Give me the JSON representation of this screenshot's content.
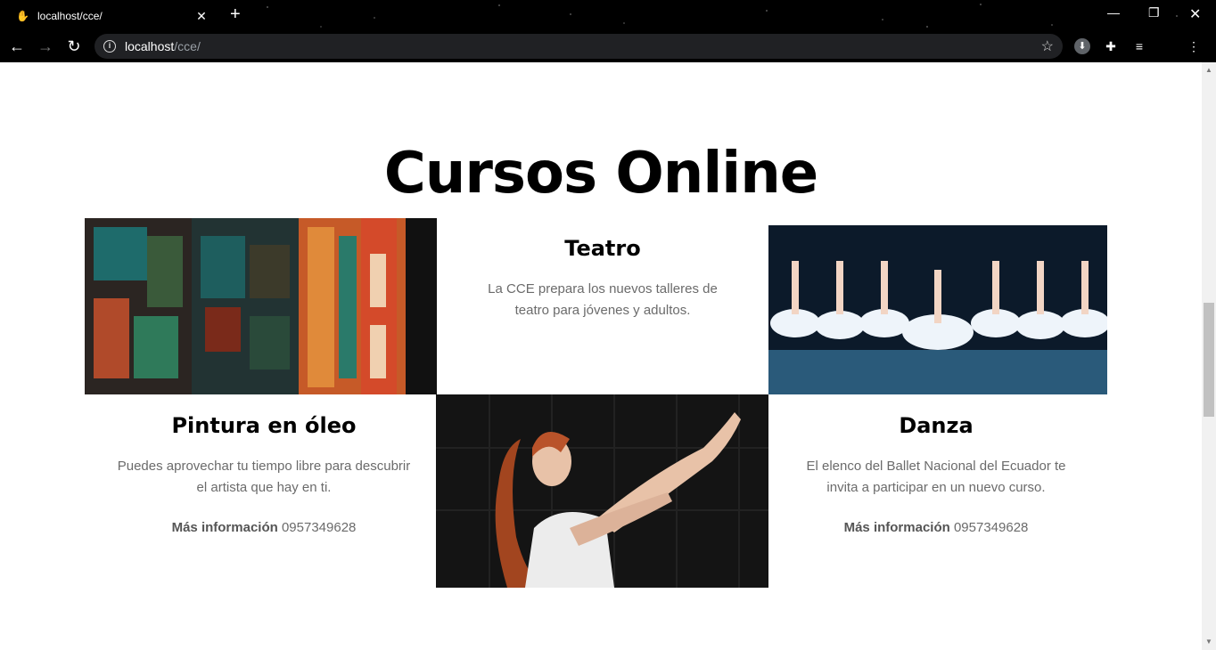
{
  "browser": {
    "tab_title": "localhost/cce/",
    "url_host": "localhost",
    "url_path": "/cce/"
  },
  "page": {
    "section_title": "Cursos Online",
    "courses": [
      {
        "title": "Teatro",
        "description": "La CCE prepara los nuevos talleres de teatro para jóvenes y adultos."
      },
      {
        "title": "Pintura en óleo",
        "description": "Puedes aprovechar tu tiempo libre para descubrir el artista que hay en ti.",
        "more_label": "Más información",
        "phone": "0957349628"
      },
      {
        "title": "Danza",
        "description": "El elenco del Ballet Nacional del Ecuador te invita a participar en un nuevo curso.",
        "more_label": "Más información",
        "phone": "0957349628"
      }
    ]
  }
}
